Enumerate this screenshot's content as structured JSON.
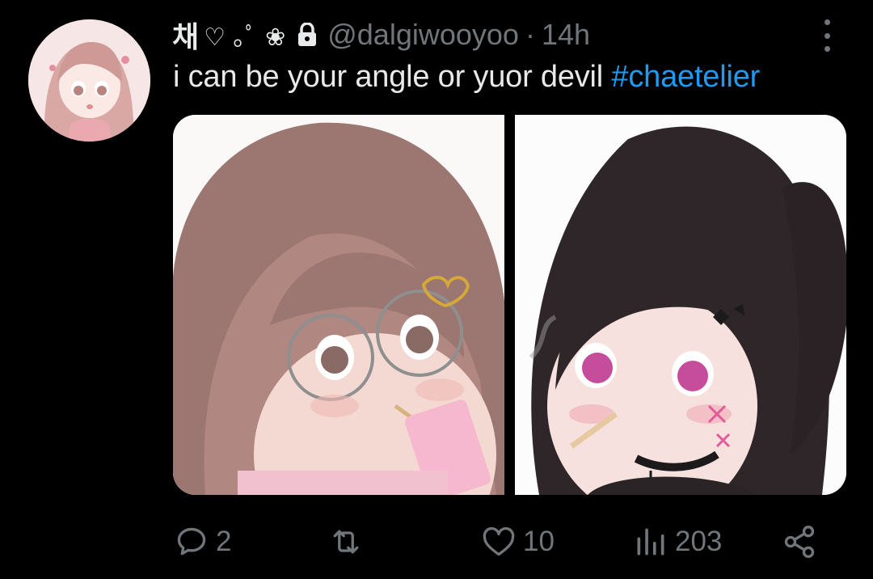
{
  "tweet": {
    "author": {
      "display_name": "채",
      "display_name_deco": "♡ ｡ﾟ ❀",
      "handle": "@dalgiwooyoo",
      "separator": "·",
      "time": "14h",
      "avatar_icon": "profile-avatar",
      "protected_icon": "lock-icon"
    },
    "text": "i can be your angle or yuor devil",
    "hashtag": "#chaetelier",
    "media": [
      {
        "alt_icon": "illustration-girl-glasses"
      },
      {
        "alt_icon": "illustration-girl-dark-twintails"
      }
    ],
    "actions": {
      "replies": "2",
      "reposts": "",
      "likes": "10",
      "views": "203"
    },
    "colors": {
      "background": "#000000",
      "text": "#e7e9ea",
      "muted": "#71767b",
      "link": "#1d9bf0"
    }
  }
}
